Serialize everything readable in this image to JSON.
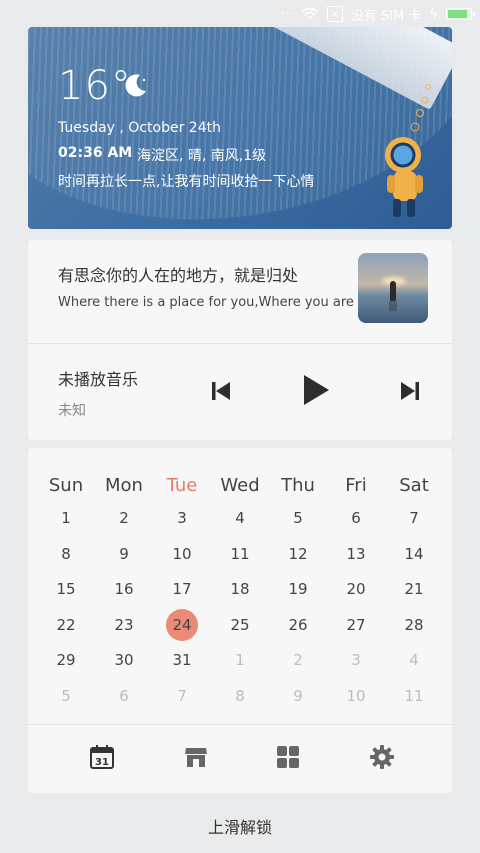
{
  "status_bar": {
    "sim_text": "没有 SIM 卡",
    "battery_level": 0.8
  },
  "weather": {
    "temperature": "16°",
    "date": "Tuesday , October 24th",
    "time": "02:36 AM",
    "location": "海淀区, 晴, 南风,1级",
    "quote": "时间再拉长一点,让我有时间收拾一下心情"
  },
  "music": {
    "song_zh": "有思念你的人在的地方，就是归处",
    "song_en": "Where there is a place for you,Where you are",
    "player_title": "未播放音乐",
    "player_artist": "未知"
  },
  "calendar": {
    "weekdays": [
      "Sun",
      "Mon",
      "Tue",
      "Wed",
      "Thu",
      "Fri",
      "Sat"
    ],
    "today_weekday_index": 2,
    "rows": [
      [
        "1",
        "2",
        "3",
        "4",
        "5",
        "6",
        "7"
      ],
      [
        "8",
        "9",
        "10",
        "11",
        "12",
        "13",
        "14"
      ],
      [
        "15",
        "16",
        "17",
        "18",
        "19",
        "20",
        "21"
      ],
      [
        "22",
        "23",
        "24",
        "25",
        "26",
        "27",
        "28"
      ],
      [
        "29",
        "30",
        "31",
        "1",
        "2",
        "3",
        "4"
      ],
      [
        "5",
        "6",
        "7",
        "8",
        "9",
        "10",
        "11"
      ]
    ],
    "today": "24"
  },
  "bottom_icons": [
    "calendar-icon",
    "store-icon",
    "apps-grid-icon",
    "gear-icon"
  ],
  "calendar_icon_day": "31",
  "unlock_text": "上滑解锁",
  "colors": {
    "accent": "#e67d63",
    "today_circle": "#e98b77",
    "weather_bg": "#3b6da2",
    "battery": "#7ee081"
  }
}
